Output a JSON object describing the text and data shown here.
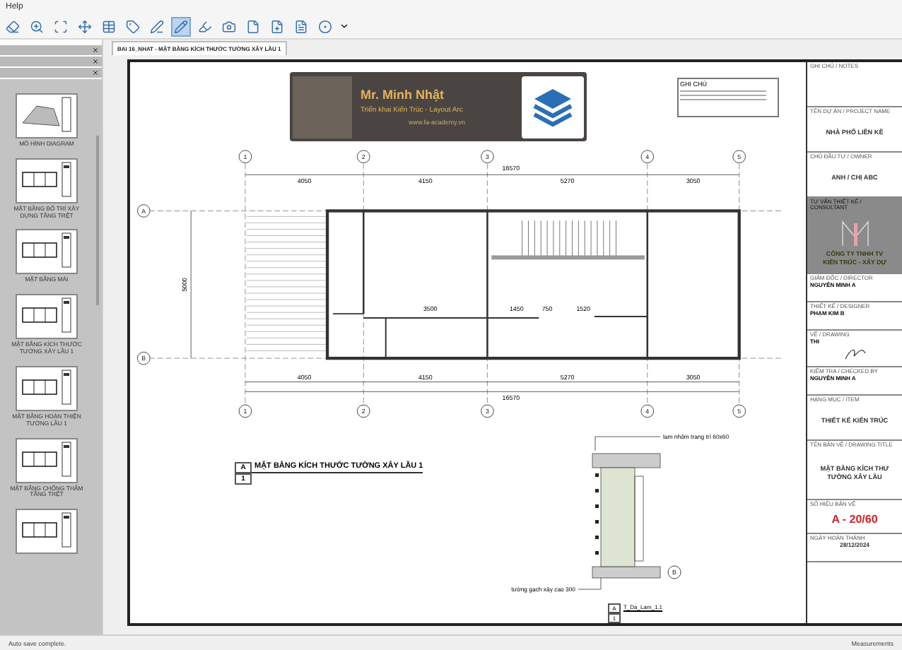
{
  "menu_bar": {
    "items": [
      "Help"
    ]
  },
  "toolbar": {
    "tools": [
      {
        "kind": "eraser",
        "selected": false
      },
      {
        "kind": "zoom",
        "selected": false
      },
      {
        "kind": "scan",
        "selected": false
      },
      {
        "kind": "move",
        "selected": false
      },
      {
        "kind": "table",
        "selected": false
      },
      {
        "kind": "tag",
        "selected": false
      },
      {
        "kind": "line",
        "selected": false
      },
      {
        "kind": "pencil",
        "selected": true
      },
      {
        "kind": "highlighter",
        "selected": false
      },
      {
        "kind": "camera",
        "selected": false
      },
      {
        "kind": "file",
        "selected": false
      },
      {
        "kind": "file-plus",
        "selected": false
      },
      {
        "kind": "file-text",
        "selected": false
      },
      {
        "kind": "target",
        "selected": false
      }
    ]
  },
  "left_panel": {
    "thumbnails": [
      {
        "label": "MÔ HÌNH DIAGRAM",
        "kind": "model"
      },
      {
        "label": "MẶT BẰNG BỐ TRÍ XÂY DỰNG TẦNG TRỆT",
        "kind": "plan"
      },
      {
        "label": "MẶT BẰNG MÁI",
        "kind": "plan"
      },
      {
        "label": "MẶT BẰNG KÍCH THƯỚC TƯỜNG XÂY LẦU 1",
        "kind": "plan"
      },
      {
        "label": "MẶT BẰNG HOÀN THIỆN TƯỜNG LẦU 1",
        "kind": "plan"
      },
      {
        "label": "MẶT BẰNG CHỐNG THẤM TẦNG TRỆT",
        "kind": "plan"
      },
      {
        "kind": "plan"
      }
    ]
  },
  "document_tab": {
    "title": "BAI 16_NHAT - MẶT BẰNG KÍCH THƯỚC TƯỜNG XÂY LẦU 1"
  },
  "banner": {
    "name": "Mr. Minh Nhật",
    "subtitle": "Triển khai Kiến Trúc - Layout Arc",
    "website": "www.fa-academy.vn"
  },
  "notes": {
    "heading": "GHI CHÚ"
  },
  "plan": {
    "grid_columns": [
      "1",
      "2",
      "3",
      "4",
      "5"
    ],
    "bottom_grid_columns": [
      "1",
      "2",
      "3",
      "4",
      "5"
    ],
    "grid_rows": [
      "A",
      "B"
    ],
    "overall_dimension": "16570",
    "bottom_overall_dimension": "16570",
    "bay_dimensions": [
      "4050",
      "4150",
      "5270",
      "3050"
    ],
    "bottom_bay_dimensions": [
      "4050",
      "4150",
      "5270",
      "3050"
    ],
    "height_dimension": "5000",
    "room_dimensions": [
      "3500",
      "1450",
      "750",
      "1520"
    ]
  },
  "view_title": {
    "marker": "A",
    "number": "1",
    "title": "MẶT BẰNG KÍCH THƯỚC TƯỜNG XÂY LẦU 1"
  },
  "detail": {
    "top_note": "lam nhôm trang trí 60x60",
    "bottom_note": "tường gạch xây cao 300",
    "grid_label": "B",
    "marker": "A",
    "number": "1",
    "title": "T_Da_Lam_1.1"
  },
  "title_block": {
    "rows": [
      {
        "kind": "notes",
        "label": "GHI CHÚ / NOTES"
      },
      {
        "kind": "large",
        "label": "TÊN DỰ ÁN / PROJECT NAME",
        "value": "NHÀ PHỐ LIỀN KỀ"
      },
      {
        "kind": "large",
        "label": "CHỦ ĐẦU TƯ / OWNER",
        "value": "ANH / CHỊ ABC"
      },
      {
        "kind": "logo",
        "label": "TƯ VẤN THIẾT KẾ / CONSULTANT",
        "value": "CÔNG TY TNHH TV",
        "value2": "KIẾN TRÚC - XÂY DỰ"
      },
      {
        "kind": "small",
        "label": "GIÁM ĐỐC / DIRECTOR",
        "value": "NGUYỄN MINH A"
      },
      {
        "kind": "small",
        "label": "THIẾT KẾ / DESIGNER",
        "value": "PHẠM KIM B"
      },
      {
        "kind": "signature",
        "label": "VẼ / DRAWING",
        "value": "THI"
      },
      {
        "kind": "small",
        "label": "KIỂM TRA / CHECKED BY",
        "value": "NGUYỄN MINH A"
      },
      {
        "kind": "large",
        "label": "HẠNG MỤC / ITEM",
        "value": "THIẾT KẾ KIẾN TRÚC"
      },
      {
        "kind": "large",
        "label": "TÊN BẢN VẼ / DRAWING TITLE",
        "value": "MẶT BẰNG KÍCH THƯ",
        "value2": "TƯỜNG XÂY LẦU"
      },
      {
        "kind": "number",
        "label": "SỐ HIỆU BẢN VẼ",
        "value": "A - 20/60"
      },
      {
        "kind": "date",
        "label": "NGÀY HOÀN THÀNH",
        "value": "28/12/2024"
      }
    ]
  },
  "status_bar": {
    "message": "Auto save complete.",
    "right": "Measurements"
  }
}
